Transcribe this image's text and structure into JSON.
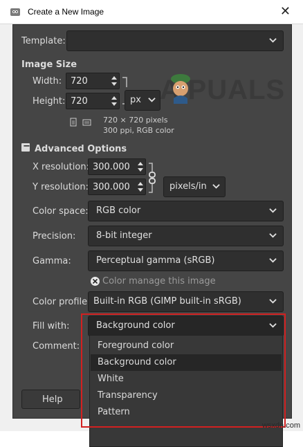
{
  "window": {
    "title": "Create a New Image",
    "close_glyph": "✕"
  },
  "template": {
    "label": "Template:",
    "value": ""
  },
  "image_size": {
    "heading": "Image Size",
    "width_label": "Width:",
    "width_value": "720",
    "height_label": "Height:",
    "height_value": "720",
    "unit": "px",
    "info_line1": "720 × 720 pixels",
    "info_line2": "300 ppi, RGB color"
  },
  "advanced": {
    "toggle_glyph": "−",
    "heading": "Advanced Options",
    "xres_label": "X resolution:",
    "xres_value": "300.000",
    "yres_label": "Y resolution:",
    "yres_value": "300.000",
    "res_unit": "pixels/in",
    "color_space_label": "Color space:",
    "color_space_value": "RGB color",
    "precision_label": "Precision:",
    "precision_value": "8-bit integer",
    "gamma_label": "Gamma:",
    "gamma_value": "Perceptual gamma (sRGB)",
    "color_manage_label": "Color manage this image",
    "color_profile_label": "Color profile:",
    "color_profile_value": "Built-in RGB (GIMP built-in sRGB)",
    "fill_label": "Fill with:",
    "fill_value": "Background color",
    "comment_label": "Comment:"
  },
  "fill_options": [
    "Foreground color",
    "Background color",
    "White",
    "Transparency",
    "Pattern"
  ],
  "buttons": {
    "help": "Help"
  },
  "watermark": "A  PUALS",
  "site": "wsxdn.com",
  "colors": {
    "panel_bg": "#454545",
    "field_bg": "#2f2f2f",
    "highlight": "#d32020"
  }
}
